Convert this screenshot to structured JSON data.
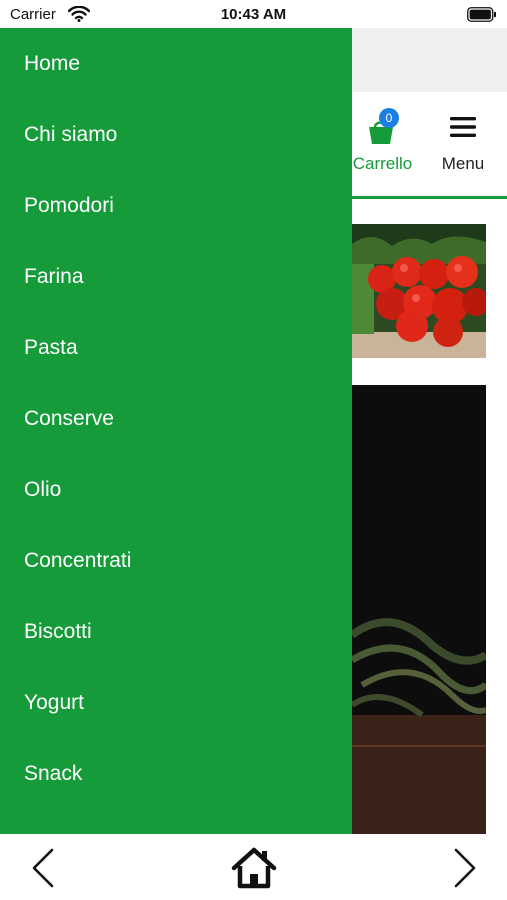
{
  "status_bar": {
    "carrier": "Carrier",
    "time": "10:43 AM",
    "wifi_icon": "wifi-icon",
    "battery_icon": "battery-icon"
  },
  "header": {
    "cart": {
      "label": "Carrello",
      "badge": "0",
      "icon": "shopping-cart-icon"
    },
    "menu": {
      "label": "Menu",
      "icon": "hamburger-icon"
    }
  },
  "drawer": {
    "items": [
      {
        "label": "Home"
      },
      {
        "label": "Chi siamo"
      },
      {
        "label": "Pomodori"
      },
      {
        "label": "Farina"
      },
      {
        "label": "Pasta"
      },
      {
        "label": "Conserve"
      },
      {
        "label": "Olio"
      },
      {
        "label": "Concentrati"
      },
      {
        "label": "Biscotti"
      },
      {
        "label": "Yogurt"
      },
      {
        "label": "Snack"
      }
    ]
  },
  "bottom_bar": {
    "back_icon": "chevron-left-icon",
    "home_icon": "home-icon",
    "forward_icon": "chevron-right-icon"
  },
  "colors": {
    "drawer_bg": "#169b3a",
    "accent_green": "#169b3a",
    "badge_blue": "#1a7fe0"
  }
}
